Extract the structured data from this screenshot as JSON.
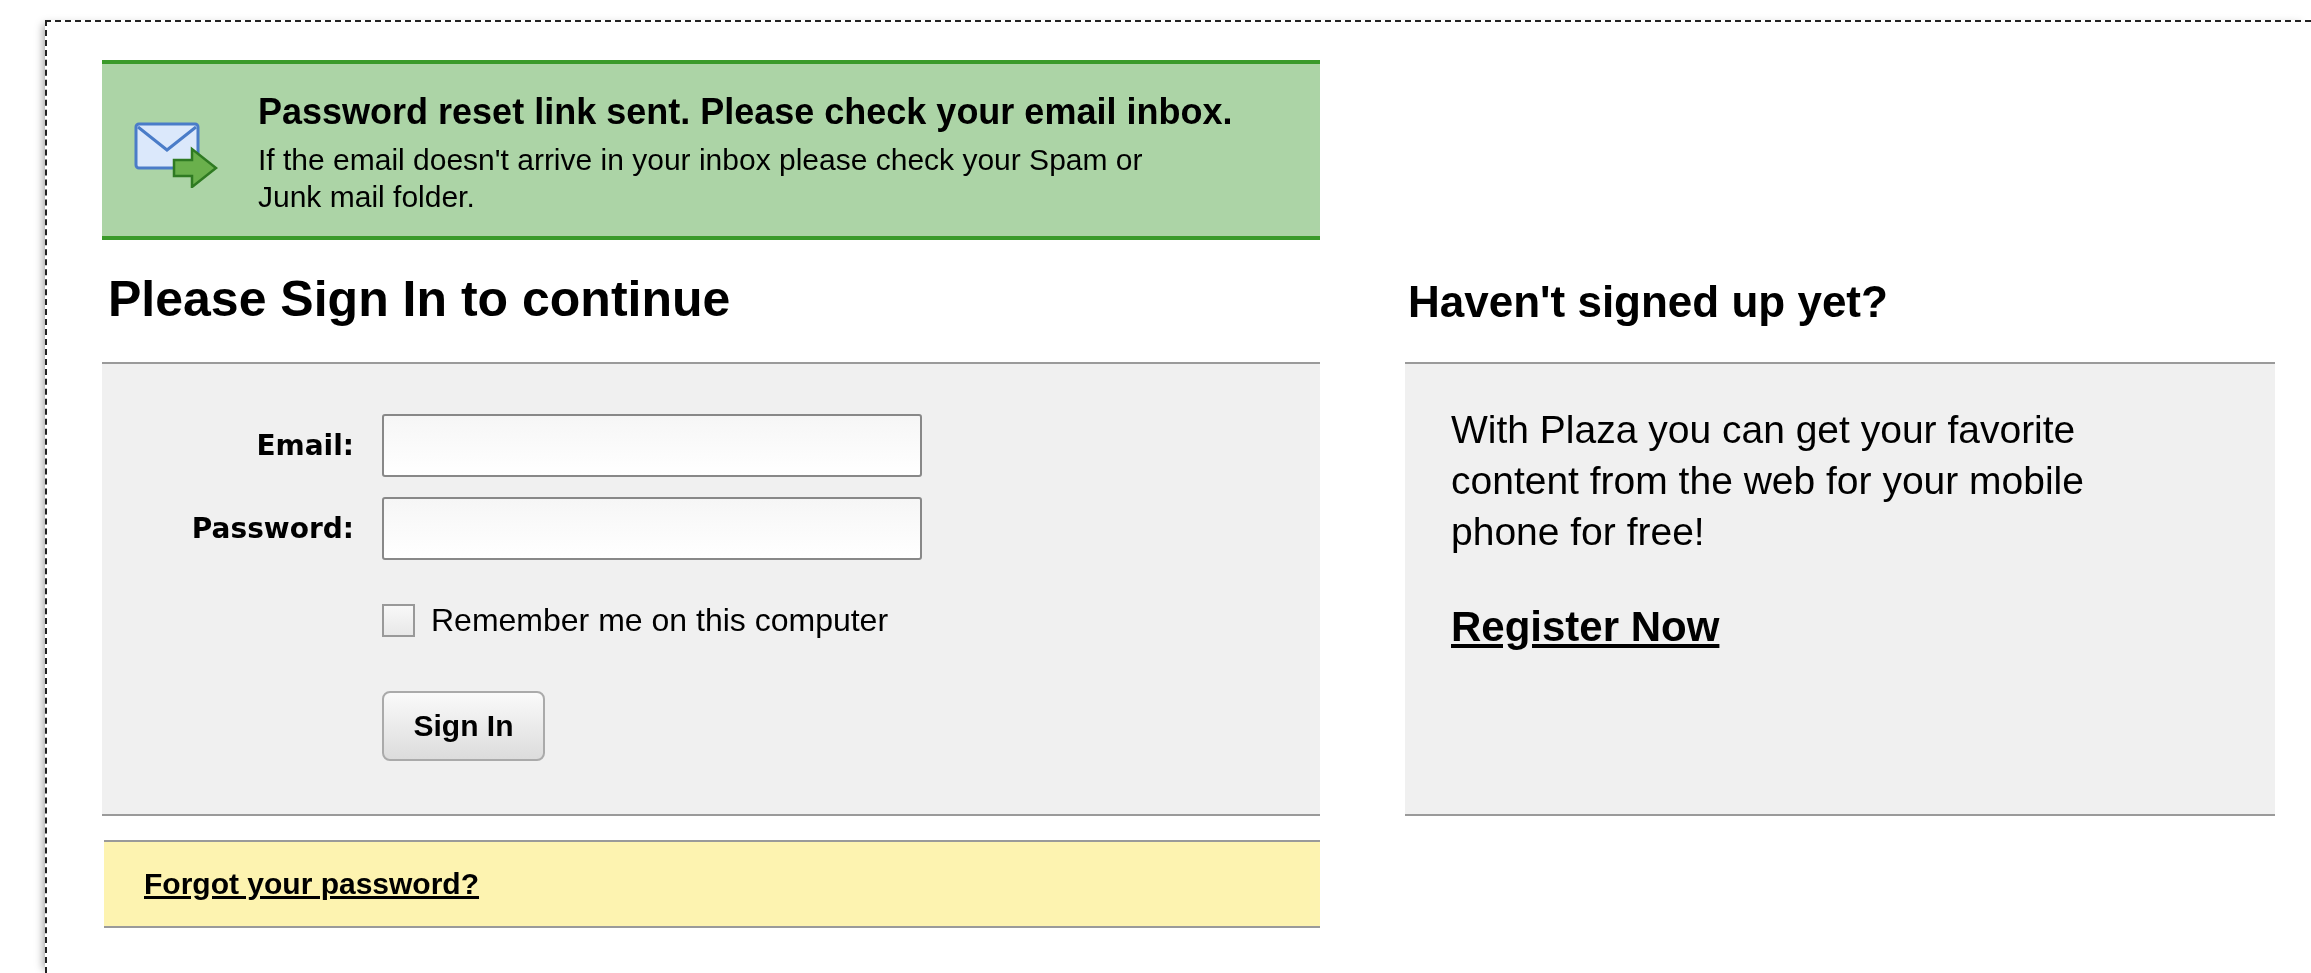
{
  "notice": {
    "title": "Password reset link sent. Please check your email inbox.",
    "message": "If the email doesn't arrive in your inbox please check your Spam or Junk mail folder."
  },
  "sign_in": {
    "heading": "Please Sign In to continue",
    "fields": [
      {
        "label": "Email:"
      },
      {
        "label": "Password:"
      }
    ],
    "remember": {
      "label": "Remember me on this computer",
      "checked": false
    },
    "button": "Sign In",
    "forgot_link": "Forgot your password?"
  },
  "sign_up": {
    "heading": "Haven't signed up yet?",
    "text": "With Plaza you can get your favorite content from the web for your mobile phone for free!",
    "link": "Register Now"
  }
}
